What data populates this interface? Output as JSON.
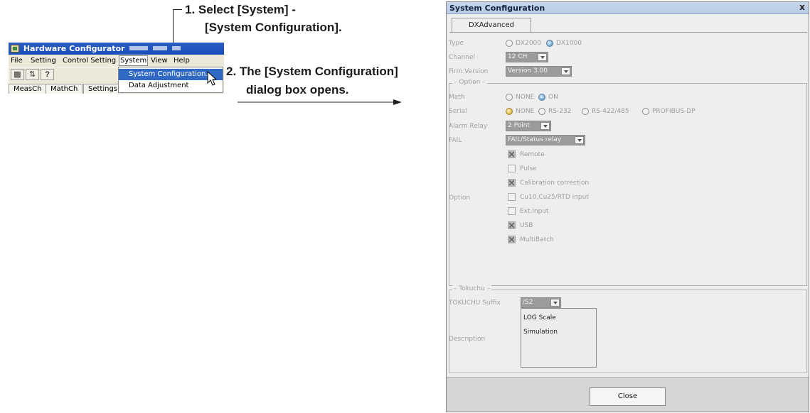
{
  "annotations": {
    "step1_line1": "1. Select [System] -",
    "step1_line2": "[System Configuration].",
    "step2_line1": "2. The [System Configuration]",
    "step2_line2": "dialog box opens."
  },
  "hardware_configurator": {
    "title": "Hardware Configurator",
    "menus": [
      "File",
      "Setting",
      "Control Setting",
      "System",
      "View",
      "Help"
    ],
    "active_menu": "System",
    "toolbar_icons": [
      "print-icon",
      "transfer-icon",
      "help-icon"
    ],
    "tabs": [
      "MeasCh",
      "MathCh",
      "Settings"
    ],
    "dropdown_items": [
      "System Configuration...",
      "Data Adjustment"
    ]
  },
  "dialog": {
    "title": "System Configuration",
    "close_glyph": "x",
    "tab": "DXAdvanced",
    "type": {
      "label": "Type",
      "options": [
        "DX2000",
        "DX1000"
      ],
      "selected": "DX1000"
    },
    "channel": {
      "label": "Channel",
      "value": "12 CH"
    },
    "firm_version": {
      "label": "Firm.Version",
      "value": "Version 3.00"
    },
    "option_group": {
      "title": "Option",
      "math": {
        "label": "Math",
        "options": [
          "NONE",
          "ON"
        ],
        "selected": "ON"
      },
      "serial": {
        "label": "Serial",
        "options": [
          "NONE",
          "RS-232",
          "RS-422/485",
          "PROFIBUS-DP"
        ],
        "selected": "NONE"
      },
      "alarm_relay": {
        "label": "Alarm Relay",
        "value": "2 Point"
      },
      "fail": {
        "label": "FAIL",
        "value": "FAIL/Status relay"
      },
      "option_label": "Option",
      "checkboxes": [
        {
          "label": "Remote",
          "checked": true
        },
        {
          "label": "Pulse",
          "checked": false
        },
        {
          "label": "Calibration correction",
          "checked": true
        },
        {
          "label": "Cu10,Cu25/RTD input",
          "checked": false
        },
        {
          "label": "Ext.input",
          "checked": false
        },
        {
          "label": "USB",
          "checked": true
        },
        {
          "label": "MultiBatch",
          "checked": true
        }
      ]
    },
    "tokuchu_group": {
      "title": "Tokuchu",
      "suffix_label": "TOKUCHU Suffix",
      "suffix_value": "/S2",
      "description_label": "Description",
      "description_items": [
        "LOG Scale",
        "Simulation"
      ]
    },
    "close_button": "Close"
  },
  "colors": {
    "title_bar": "#174fb8",
    "dialog_bg": "#eeeeee",
    "menu_highlight": "#316ac5"
  }
}
